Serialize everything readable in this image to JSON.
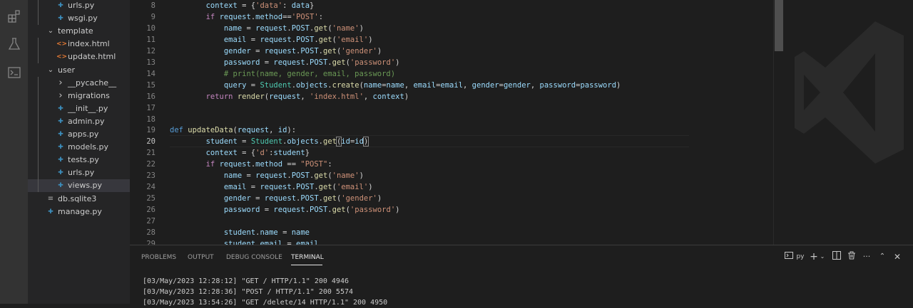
{
  "sidebar": {
    "items": [
      {
        "label": "urls.py",
        "type": "py",
        "depth": 2
      },
      {
        "label": "wsgi.py",
        "type": "py",
        "depth": 2
      },
      {
        "label": "template",
        "type": "folder-open",
        "depth": 1
      },
      {
        "label": "index.html",
        "type": "html",
        "depth": 2
      },
      {
        "label": "update.html",
        "type": "html",
        "depth": 2
      },
      {
        "label": "user",
        "type": "folder-open",
        "depth": 1
      },
      {
        "label": "__pycache__",
        "type": "folder-closed",
        "depth": 2
      },
      {
        "label": "migrations",
        "type": "folder-closed",
        "depth": 2
      },
      {
        "label": "__init__.py",
        "type": "py",
        "depth": 2
      },
      {
        "label": "admin.py",
        "type": "py",
        "depth": 2
      },
      {
        "label": "apps.py",
        "type": "py",
        "depth": 2
      },
      {
        "label": "models.py",
        "type": "py",
        "depth": 2
      },
      {
        "label": "tests.py",
        "type": "py",
        "depth": 2
      },
      {
        "label": "urls.py",
        "type": "py",
        "depth": 2
      },
      {
        "label": "views.py",
        "type": "py",
        "depth": 2,
        "selected": true
      },
      {
        "label": "db.sqlite3",
        "type": "db",
        "depth": 1
      },
      {
        "label": "manage.py",
        "type": "py",
        "depth": 1
      }
    ]
  },
  "editor": {
    "line_numbers": [
      "8",
      "9",
      "10",
      "11",
      "12",
      "13",
      "14",
      "15",
      "16",
      "17",
      "18",
      "19",
      "20",
      "21",
      "22",
      "23",
      "24",
      "25",
      "26",
      "27",
      "28",
      "29"
    ],
    "active_line": "20",
    "lines": [
      [
        [
          "        ",
          "op"
        ],
        [
          "context",
          "var"
        ],
        [
          " = {",
          "op"
        ],
        [
          "'data'",
          "str"
        ],
        [
          ": ",
          "op"
        ],
        [
          "data",
          "var"
        ],
        [
          "}",
          "op"
        ]
      ],
      [
        [
          "        ",
          "op"
        ],
        [
          "if",
          "kw"
        ],
        [
          " ",
          "op"
        ],
        [
          "request",
          "var"
        ],
        [
          ".",
          "op"
        ],
        [
          "method",
          "var"
        ],
        [
          "==",
          "op"
        ],
        [
          "'POST'",
          "str"
        ],
        [
          ":",
          "op"
        ]
      ],
      [
        [
          "            ",
          "op"
        ],
        [
          "name",
          "var"
        ],
        [
          " = ",
          "op"
        ],
        [
          "request",
          "var"
        ],
        [
          ".",
          "op"
        ],
        [
          "POST",
          "var"
        ],
        [
          ".",
          "op"
        ],
        [
          "get",
          "fn"
        ],
        [
          "(",
          "op"
        ],
        [
          "'name'",
          "str"
        ],
        [
          ")",
          "op"
        ]
      ],
      [
        [
          "            ",
          "op"
        ],
        [
          "email",
          "var"
        ],
        [
          " = ",
          "op"
        ],
        [
          "request",
          "var"
        ],
        [
          ".",
          "op"
        ],
        [
          "POST",
          "var"
        ],
        [
          ".",
          "op"
        ],
        [
          "get",
          "fn"
        ],
        [
          "(",
          "op"
        ],
        [
          "'email'",
          "str"
        ],
        [
          ")",
          "op"
        ]
      ],
      [
        [
          "            ",
          "op"
        ],
        [
          "gender",
          "var"
        ],
        [
          " = ",
          "op"
        ],
        [
          "request",
          "var"
        ],
        [
          ".",
          "op"
        ],
        [
          "POST",
          "var"
        ],
        [
          ".",
          "op"
        ],
        [
          "get",
          "fn"
        ],
        [
          "(",
          "op"
        ],
        [
          "'gender'",
          "str"
        ],
        [
          ")",
          "op"
        ]
      ],
      [
        [
          "            ",
          "op"
        ],
        [
          "password",
          "var"
        ],
        [
          " = ",
          "op"
        ],
        [
          "request",
          "var"
        ],
        [
          ".",
          "op"
        ],
        [
          "POST",
          "var"
        ],
        [
          ".",
          "op"
        ],
        [
          "get",
          "fn"
        ],
        [
          "(",
          "op"
        ],
        [
          "'password'",
          "str"
        ],
        [
          ")",
          "op"
        ]
      ],
      [
        [
          "            ",
          "op"
        ],
        [
          "# print(name, gender, email, password)",
          "com"
        ]
      ],
      [
        [
          "            ",
          "op"
        ],
        [
          "query",
          "var"
        ],
        [
          " = ",
          "op"
        ],
        [
          "Student",
          "cls"
        ],
        [
          ".",
          "op"
        ],
        [
          "objects",
          "var"
        ],
        [
          ".",
          "op"
        ],
        [
          "create",
          "fn"
        ],
        [
          "(",
          "op"
        ],
        [
          "name",
          "var"
        ],
        [
          "=",
          "op"
        ],
        [
          "name",
          "var"
        ],
        [
          ", ",
          "op"
        ],
        [
          "email",
          "var"
        ],
        [
          "=",
          "op"
        ],
        [
          "email",
          "var"
        ],
        [
          ", ",
          "op"
        ],
        [
          "gender",
          "var"
        ],
        [
          "=",
          "op"
        ],
        [
          "gender",
          "var"
        ],
        [
          ", ",
          "op"
        ],
        [
          "password",
          "var"
        ],
        [
          "=",
          "op"
        ],
        [
          "password",
          "var"
        ],
        [
          ")",
          "op"
        ]
      ],
      [
        [
          "        ",
          "op"
        ],
        [
          "return",
          "kw"
        ],
        [
          " ",
          "op"
        ],
        [
          "render",
          "fn"
        ],
        [
          "(",
          "op"
        ],
        [
          "request",
          "var"
        ],
        [
          ", ",
          "op"
        ],
        [
          "'index.html'",
          "str"
        ],
        [
          ", ",
          "op"
        ],
        [
          "context",
          "var"
        ],
        [
          ")",
          "op"
        ]
      ],
      [],
      [],
      [
        [
          "def",
          "def"
        ],
        [
          " ",
          "op"
        ],
        [
          "updateData",
          "fn"
        ],
        [
          "(",
          "op"
        ],
        [
          "request",
          "var"
        ],
        [
          ", ",
          "op"
        ],
        [
          "id",
          "var"
        ],
        [
          "):",
          "op"
        ]
      ],
      [
        [
          "        ",
          "op"
        ],
        [
          "student",
          "var"
        ],
        [
          " = ",
          "op"
        ],
        [
          "Student",
          "cls"
        ],
        [
          ".",
          "op"
        ],
        [
          "objects",
          "var"
        ],
        [
          ".",
          "op"
        ],
        [
          "get",
          "fn"
        ],
        [
          "(",
          "box"
        ],
        [
          "id",
          "var"
        ],
        [
          "=",
          "op"
        ],
        [
          "id",
          "var"
        ],
        [
          ")",
          "box"
        ]
      ],
      [
        [
          "        ",
          "op"
        ],
        [
          "context",
          "var"
        ],
        [
          " = {",
          "op"
        ],
        [
          "'d'",
          "str"
        ],
        [
          ":",
          "op"
        ],
        [
          "student",
          "var"
        ],
        [
          "}",
          "op"
        ]
      ],
      [
        [
          "        ",
          "op"
        ],
        [
          "if",
          "kw"
        ],
        [
          " ",
          "op"
        ],
        [
          "request",
          "var"
        ],
        [
          ".",
          "op"
        ],
        [
          "method",
          "var"
        ],
        [
          " == ",
          "op"
        ],
        [
          "\"POST\"",
          "str"
        ],
        [
          ":",
          "op"
        ]
      ],
      [
        [
          "            ",
          "op"
        ],
        [
          "name",
          "var"
        ],
        [
          " = ",
          "op"
        ],
        [
          "request",
          "var"
        ],
        [
          ".",
          "op"
        ],
        [
          "POST",
          "var"
        ],
        [
          ".",
          "op"
        ],
        [
          "get",
          "fn"
        ],
        [
          "(",
          "op"
        ],
        [
          "'name'",
          "str"
        ],
        [
          ")",
          "op"
        ]
      ],
      [
        [
          "            ",
          "op"
        ],
        [
          "email",
          "var"
        ],
        [
          " = ",
          "op"
        ],
        [
          "request",
          "var"
        ],
        [
          ".",
          "op"
        ],
        [
          "POST",
          "var"
        ],
        [
          ".",
          "op"
        ],
        [
          "get",
          "fn"
        ],
        [
          "(",
          "op"
        ],
        [
          "'email'",
          "str"
        ],
        [
          ")",
          "op"
        ]
      ],
      [
        [
          "            ",
          "op"
        ],
        [
          "gender",
          "var"
        ],
        [
          " = ",
          "op"
        ],
        [
          "request",
          "var"
        ],
        [
          ".",
          "op"
        ],
        [
          "POST",
          "var"
        ],
        [
          ".",
          "op"
        ],
        [
          "get",
          "fn"
        ],
        [
          "(",
          "op"
        ],
        [
          "'gender'",
          "str"
        ],
        [
          ")",
          "op"
        ]
      ],
      [
        [
          "            ",
          "op"
        ],
        [
          "password",
          "var"
        ],
        [
          " = ",
          "op"
        ],
        [
          "request",
          "var"
        ],
        [
          ".",
          "op"
        ],
        [
          "POST",
          "var"
        ],
        [
          ".",
          "op"
        ],
        [
          "get",
          "fn"
        ],
        [
          "(",
          "op"
        ],
        [
          "'password'",
          "str"
        ],
        [
          ")",
          "op"
        ]
      ],
      [],
      [
        [
          "            ",
          "op"
        ],
        [
          "student",
          "var"
        ],
        [
          ".",
          "op"
        ],
        [
          "name",
          "var"
        ],
        [
          " = ",
          "op"
        ],
        [
          "name",
          "var"
        ]
      ],
      [
        [
          "            ",
          "op"
        ],
        [
          "student",
          "var"
        ],
        [
          ".",
          "op"
        ],
        [
          "email",
          "var"
        ],
        [
          " = ",
          "op"
        ],
        [
          "email",
          "var"
        ]
      ]
    ]
  },
  "panel": {
    "tabs": [
      "PROBLEMS",
      "OUTPUT",
      "DEBUG CONSOLE",
      "TERMINAL"
    ],
    "active_tab": "TERMINAL",
    "terminal_shell": "py",
    "terminal_lines": [
      "[03/May/2023 12:28:12] \"GET / HTTP/1.1\" 200 4946",
      "[03/May/2023 12:28:36] \"POST / HTTP/1.1\" 200 5574",
      "[03/May/2023 13:54:26] \"GET /delete/14 HTTP/1.1\" 200 4950"
    ]
  },
  "icons": {
    "activity": [
      "extensions-icon",
      "beaker-icon",
      "terminal-icon"
    ],
    "panel_actions": [
      "terminal-shell-icon",
      "add-icon",
      "chevron-down-icon",
      "split-icon",
      "trash-icon",
      "ellipsis-icon",
      "chevron-up-icon",
      "close-icon"
    ]
  },
  "colors": {
    "background": "#1e1e1e",
    "sidebar": "#252526",
    "activity_bar": "#333333",
    "python_icon": "#3c8ebd",
    "html_icon": "#e37933",
    "keyword": "#c586c0",
    "string": "#ce9178",
    "function": "#dcdcaa",
    "variable": "#9cdcfe",
    "class": "#4ec9b0",
    "comment": "#6a9955"
  }
}
